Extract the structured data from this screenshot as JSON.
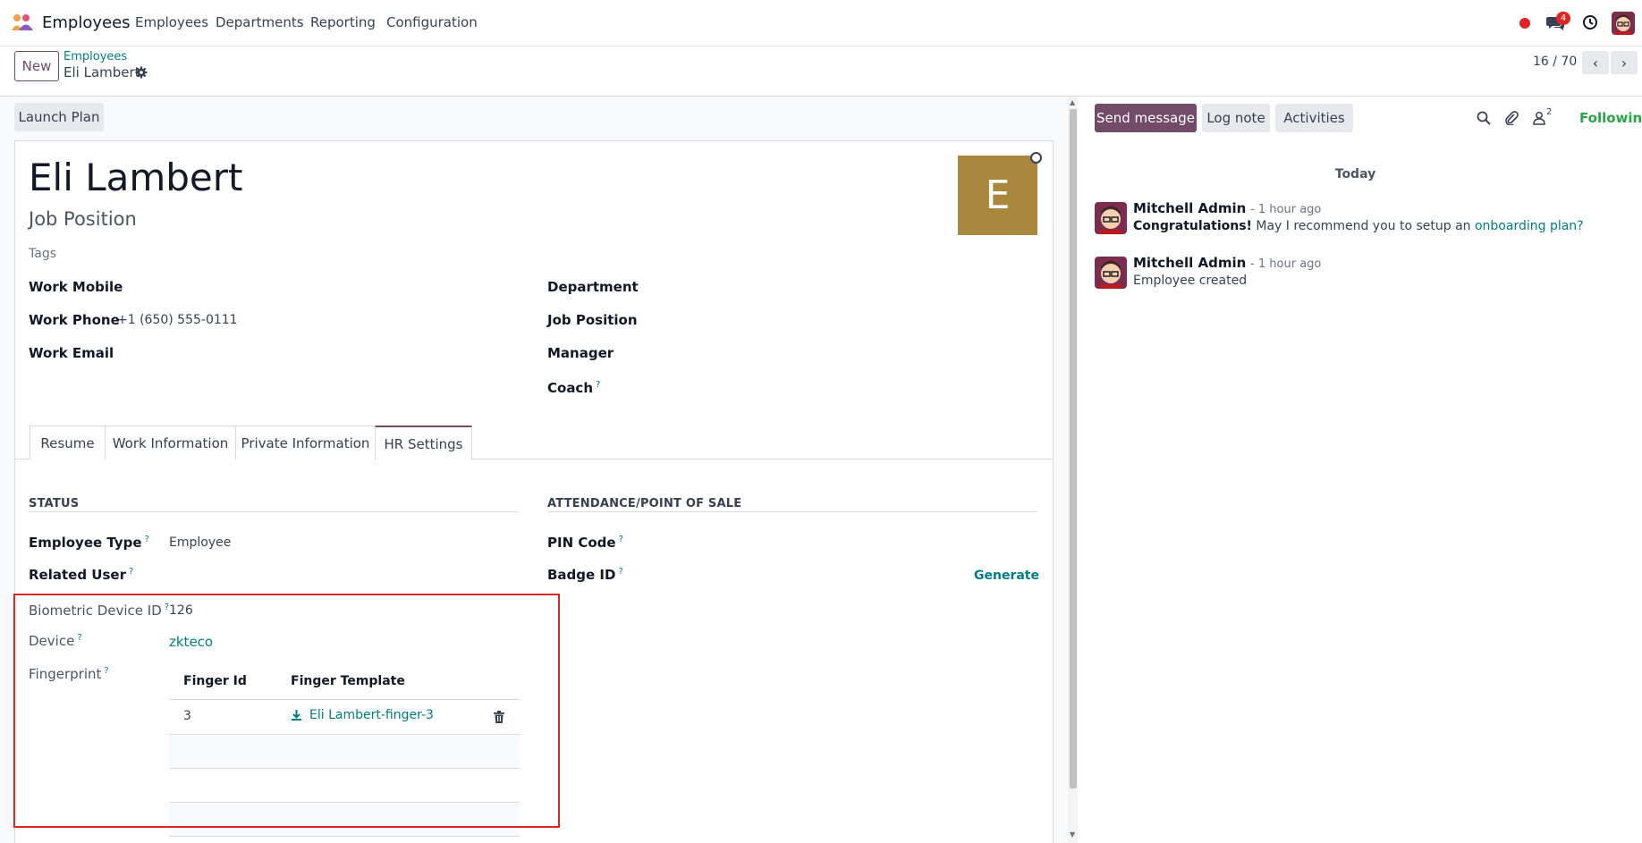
{
  "topbar": {
    "app_name": "Employees",
    "menu": [
      "Employees",
      "Departments",
      "Reporting",
      "Configuration"
    ],
    "chat_badge": "4"
  },
  "control_panel": {
    "new_label": "New",
    "breadcrumb_parent": "Employees",
    "breadcrumb_current": "Eli Lambert",
    "pager": "16 / 70"
  },
  "form": {
    "launch_plan_label": "Launch Plan",
    "employee_name": "Eli Lambert",
    "job_position_placeholder": "Job Position",
    "tags_placeholder": "Tags",
    "avatar_letter": "E",
    "left_fields": [
      {
        "label": "Work Mobile",
        "value": ""
      },
      {
        "label": "Work Phone",
        "value": "+1 (650) 555-0111"
      },
      {
        "label": "Work Email",
        "value": ""
      }
    ],
    "right_fields": [
      {
        "label": "Department",
        "value": ""
      },
      {
        "label": "Job Position",
        "value": ""
      },
      {
        "label": "Manager",
        "value": ""
      },
      {
        "label": "Coach",
        "value": "",
        "help": "?"
      }
    ],
    "tabs": [
      "Resume",
      "Work Information",
      "Private Information",
      "HR Settings"
    ],
    "active_tab": "HR Settings",
    "status_section": {
      "title": "STATUS",
      "employee_type_label": "Employee Type",
      "employee_type_value": "Employee",
      "related_user_label": "Related User",
      "biometric_label": "Biometric Device ID",
      "biometric_value": "126",
      "device_label": "Device",
      "device_value": "zkteco",
      "fingerprint_label": "Fingerprint",
      "fingerprint_columns": [
        "Finger Id",
        "Finger Template"
      ],
      "fingerprint_rows": [
        {
          "finger_id": "3",
          "template": "Eli Lambert-finger-3"
        }
      ]
    },
    "attendance_section": {
      "title": "ATTENDANCE/POINT OF SALE",
      "pin_label": "PIN Code",
      "badge_label": "Badge ID",
      "generate_label": "Generate"
    },
    "help_mark": "?"
  },
  "chatter": {
    "send_message_label": "Send message",
    "log_note_label": "Log note",
    "activities_label": "Activities",
    "followers_count": "2",
    "following_label": "Following",
    "date_separator": "Today",
    "messages": [
      {
        "author": "Mitchell Admin",
        "time": "- 1 hour ago",
        "bold": "Congratulations!",
        "text": " May I recommend you to setup an ",
        "link": "onboarding plan?"
      },
      {
        "author": "Mitchell Admin",
        "time": "- 1 hour ago",
        "text": "Employee created"
      }
    ]
  },
  "colors": {
    "brand": "#714b67",
    "link": "#017e84",
    "avatar_bg": "#a9873c",
    "highlight_box": "#e02424",
    "following": "#28a745"
  }
}
